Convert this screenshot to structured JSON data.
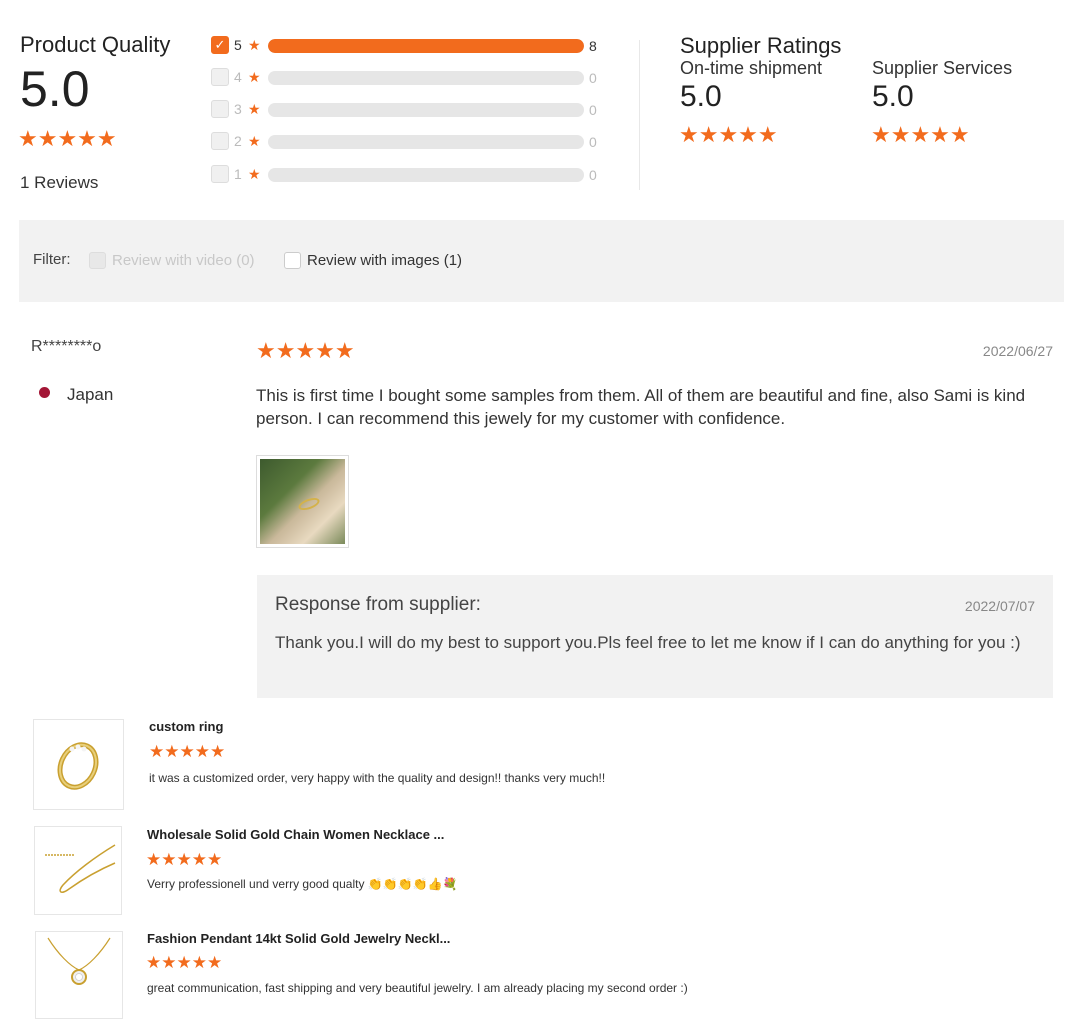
{
  "product_quality": {
    "title": "Product Quality",
    "score": "5.0",
    "stars": "★★★★★",
    "reviews": "1 Reviews",
    "distribution": [
      {
        "stars": "5",
        "count": "8",
        "fill": 1.0,
        "checked": true
      },
      {
        "stars": "4",
        "count": "0",
        "fill": 0.0,
        "checked": false
      },
      {
        "stars": "3",
        "count": "0",
        "fill": 0.0,
        "checked": false
      },
      {
        "stars": "2",
        "count": "0",
        "fill": 0.0,
        "checked": false
      },
      {
        "stars": "1",
        "count": "0",
        "fill": 0.0,
        "checked": false
      }
    ]
  },
  "supplier_ratings": {
    "title": "Supplier Ratings",
    "ontime_label": "On-time shipment",
    "ontime_value": "5.0",
    "services_label": "Supplier Services",
    "services_value": "5.0",
    "stars": "★★★★★"
  },
  "filter": {
    "label": "Filter:",
    "video": "Review with video (0)",
    "images": "Review with images (1)"
  },
  "review": {
    "reviewer": "R********o",
    "country": "Japan",
    "stars": "★★★★★",
    "date": "2022/06/27",
    "text": "This is first time I bought some samples from them. All of them are beautiful and fine, also Sami is kind person. I can recommend this jewely for my customer with confidence.",
    "response_title": "Response from supplier:",
    "response_date": "2022/07/07",
    "response_text": "Thank you.I will do my best to support you.Pls feel free to let me know if I can do anything for you :)"
  },
  "products": [
    {
      "title": "custom ring",
      "stars": "★★★★★",
      "text": "it was a customized order, very happy with the quality and design!! thanks very much!!"
    },
    {
      "title": "Wholesale Solid Gold Chain Women Necklace ...",
      "stars": "★★★★★",
      "text": "Verry professionell und verry good qualty 👏👏👏👏👍💐"
    },
    {
      "title": "Fashion Pendant 14kt Solid Gold Jewelry Neckl...",
      "stars": "★★★★★",
      "text": "great communication, fast shipping and very beautiful jewelry. I am already placing my second order :)"
    }
  ],
  "colors": {
    "accent": "#f26b1d",
    "country_dot": "#a31636"
  }
}
